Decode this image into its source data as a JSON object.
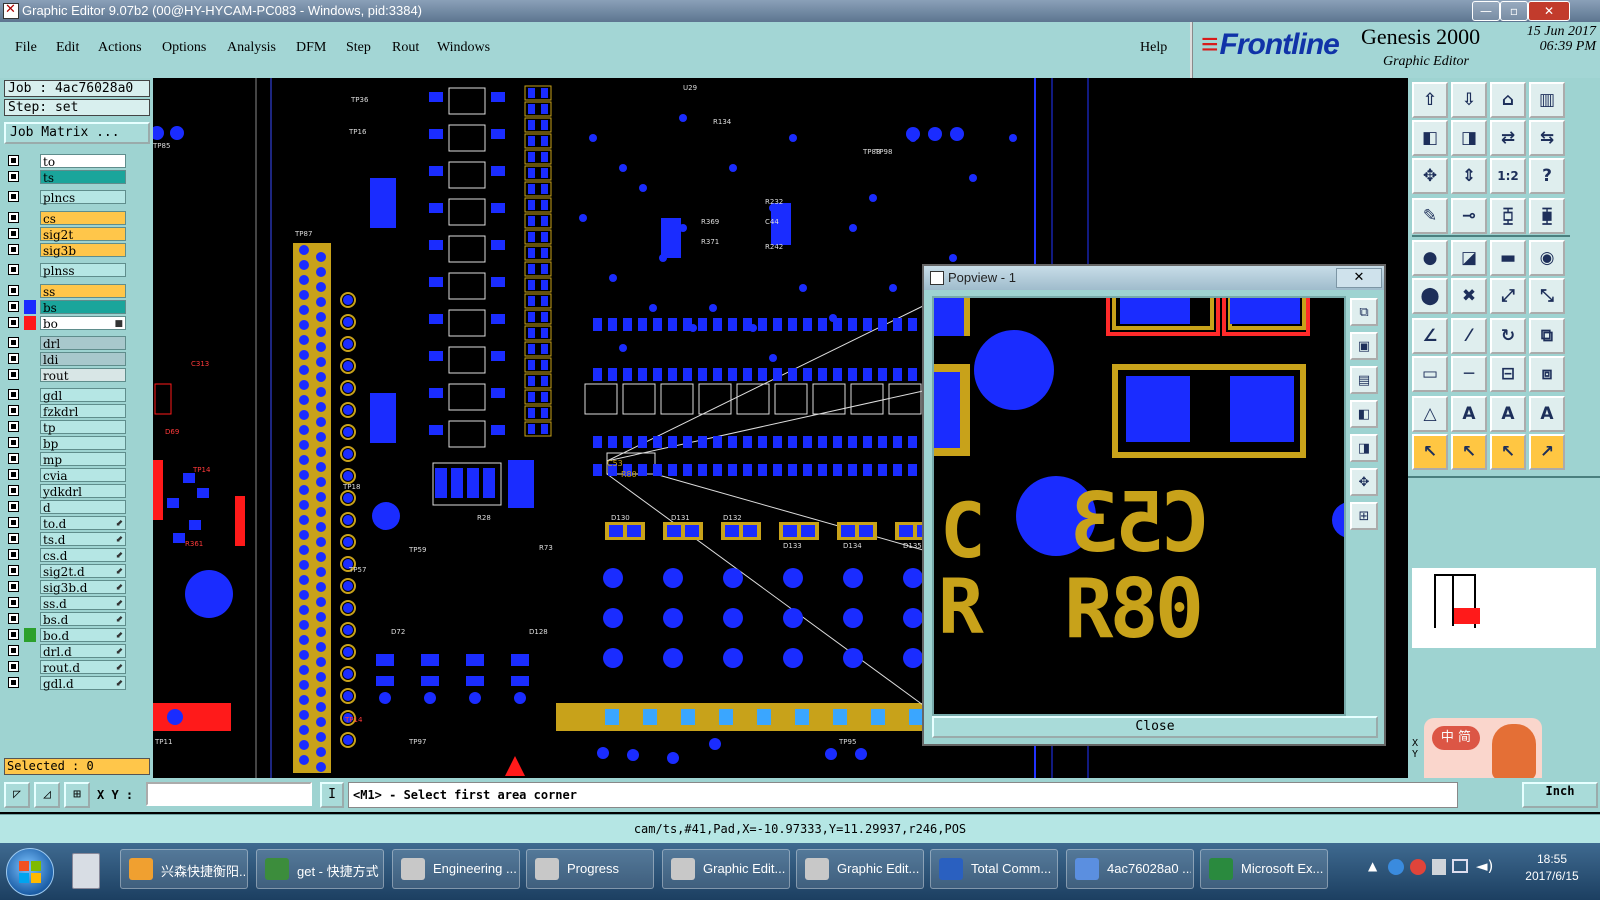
{
  "window": {
    "title": "Graphic Editor 9.07b2 (00@HY-HYCAM-PC083 - Windows, pid:3384)",
    "controls": [
      "—",
      "▫",
      "✕"
    ]
  },
  "menu": {
    "items": [
      "File",
      "Edit",
      "Actions",
      "Options",
      "Analysis",
      "DFM",
      "Step",
      "Rout",
      "Windows"
    ],
    "help": "Help"
  },
  "brand": {
    "logo": "Frontline",
    "product": "Genesis 2000",
    "subtitle": "Graphic Editor",
    "date": "15 Jun 2017",
    "time": "06:39 PM"
  },
  "job": {
    "job_label": "Job : 4ac76028a0",
    "step_label": "Step: set",
    "matrix_button": "Job Matrix ..."
  },
  "layers": [
    {
      "name": "to",
      "color": "#ffffff"
    },
    {
      "name": "ts",
      "color": "#1aa59b"
    },
    {
      "name": "plncs",
      "color": "#b5e6e4"
    },
    {
      "name": "cs",
      "color": "#ffc64a"
    },
    {
      "name": "sig2t",
      "color": "#ffc64a"
    },
    {
      "name": "sig3b",
      "color": "#ffc64a"
    },
    {
      "name": "plnss",
      "color": "#b5e6e4"
    },
    {
      "name": "ss",
      "color": "#ffc64a"
    },
    {
      "name": "bs",
      "color": "#1aa59b",
      "swatch": "#1a2cff"
    },
    {
      "name": "bo",
      "color": "#ffffff",
      "swatch": "#ff1a1a",
      "mark": "■"
    },
    {
      "name": "drl",
      "color": "#a8c8cc"
    },
    {
      "name": "ldi",
      "color": "#a8c8cc"
    },
    {
      "name": "rout",
      "color": "#d8e6e6"
    },
    {
      "name": "gdl",
      "color": "#b5e6e4"
    },
    {
      "name": "fzkdrl",
      "color": "#b5e6e4"
    },
    {
      "name": "tp",
      "color": "#b5e6e4"
    },
    {
      "name": "bp",
      "color": "#b5e6e4"
    },
    {
      "name": "mp",
      "color": "#b5e6e4"
    },
    {
      "name": "cvia",
      "color": "#b5e6e4"
    },
    {
      "name": "ydkdrl",
      "color": "#b5e6e4"
    },
    {
      "name": "d",
      "color": "#b5e6e4"
    },
    {
      "name": "to.d",
      "color": "#b5e6e4",
      "mark": "⬋"
    },
    {
      "name": "ts.d",
      "color": "#b5e6e4",
      "mark": "⬋"
    },
    {
      "name": "cs.d",
      "color": "#b5e6e4",
      "mark": "⬋"
    },
    {
      "name": "sig2t.d",
      "color": "#b5e6e4",
      "mark": "⬋"
    },
    {
      "name": "sig3b.d",
      "color": "#b5e6e4",
      "mark": "⬋"
    },
    {
      "name": "ss.d",
      "color": "#b5e6e4",
      "mark": "⬋"
    },
    {
      "name": "bs.d",
      "color": "#b5e6e4",
      "mark": "⬋"
    },
    {
      "name": "bo.d",
      "color": "#b5e6e4",
      "swatch": "#2ca02c",
      "mark": "⬋"
    },
    {
      "name": "drl.d",
      "color": "#b5e6e4",
      "mark": "⬋"
    },
    {
      "name": "rout.d",
      "color": "#b5e6e4",
      "mark": "⬋"
    },
    {
      "name": "gdl.d",
      "color": "#b5e6e4",
      "mark": "⬋"
    }
  ],
  "selected": "Selected : 0",
  "popview": {
    "title": "Popview - 1",
    "close_button": "Close",
    "labels": [
      "C53",
      "R80",
      "C",
      "R"
    ]
  },
  "canvas_labels": [
    "C53",
    "R80",
    "TP87",
    "TP18",
    "TP57",
    "TP59",
    "TP36",
    "TP16",
    "TP85",
    "TP88",
    "U29",
    "R134",
    "R232",
    "C44",
    "R242",
    "R369",
    "R371",
    "D130",
    "D131",
    "D132",
    "D133",
    "D134",
    "D135",
    "D72",
    "D128",
    "R28",
    "R73",
    "TP14",
    "TP14",
    "R361",
    "C313",
    "D69",
    "TP11",
    "TP98",
    "TP95",
    "TP97"
  ],
  "command": {
    "xy_label": "X Y :",
    "xy_value": "",
    "prompt": "<M1> - Select first area corner",
    "unit": "Inch",
    "side_xy": "X\nY"
  },
  "status": {
    "text": "cam/ts,#41,Pad,X=-10.97333,Y=11.29937,r246,POS"
  },
  "ime": {
    "text": "中 简"
  },
  "taskbar": {
    "tasks": [
      "兴森快捷衡阳...",
      "get - 快捷方式",
      "Engineering ...",
      "Progress",
      "Graphic Edit...",
      "Graphic Edit...",
      "Total Comm...",
      "4ac76028a0 ...",
      "Microsoft Ex..."
    ],
    "clock_time": "18:55",
    "clock_date": "2017/6/15"
  },
  "colors": {
    "panel": "#9ed3d1",
    "pad_blue": "#1a2cff",
    "silk_gold": "#c8a21a",
    "mask_red": "#ff1a1a"
  }
}
